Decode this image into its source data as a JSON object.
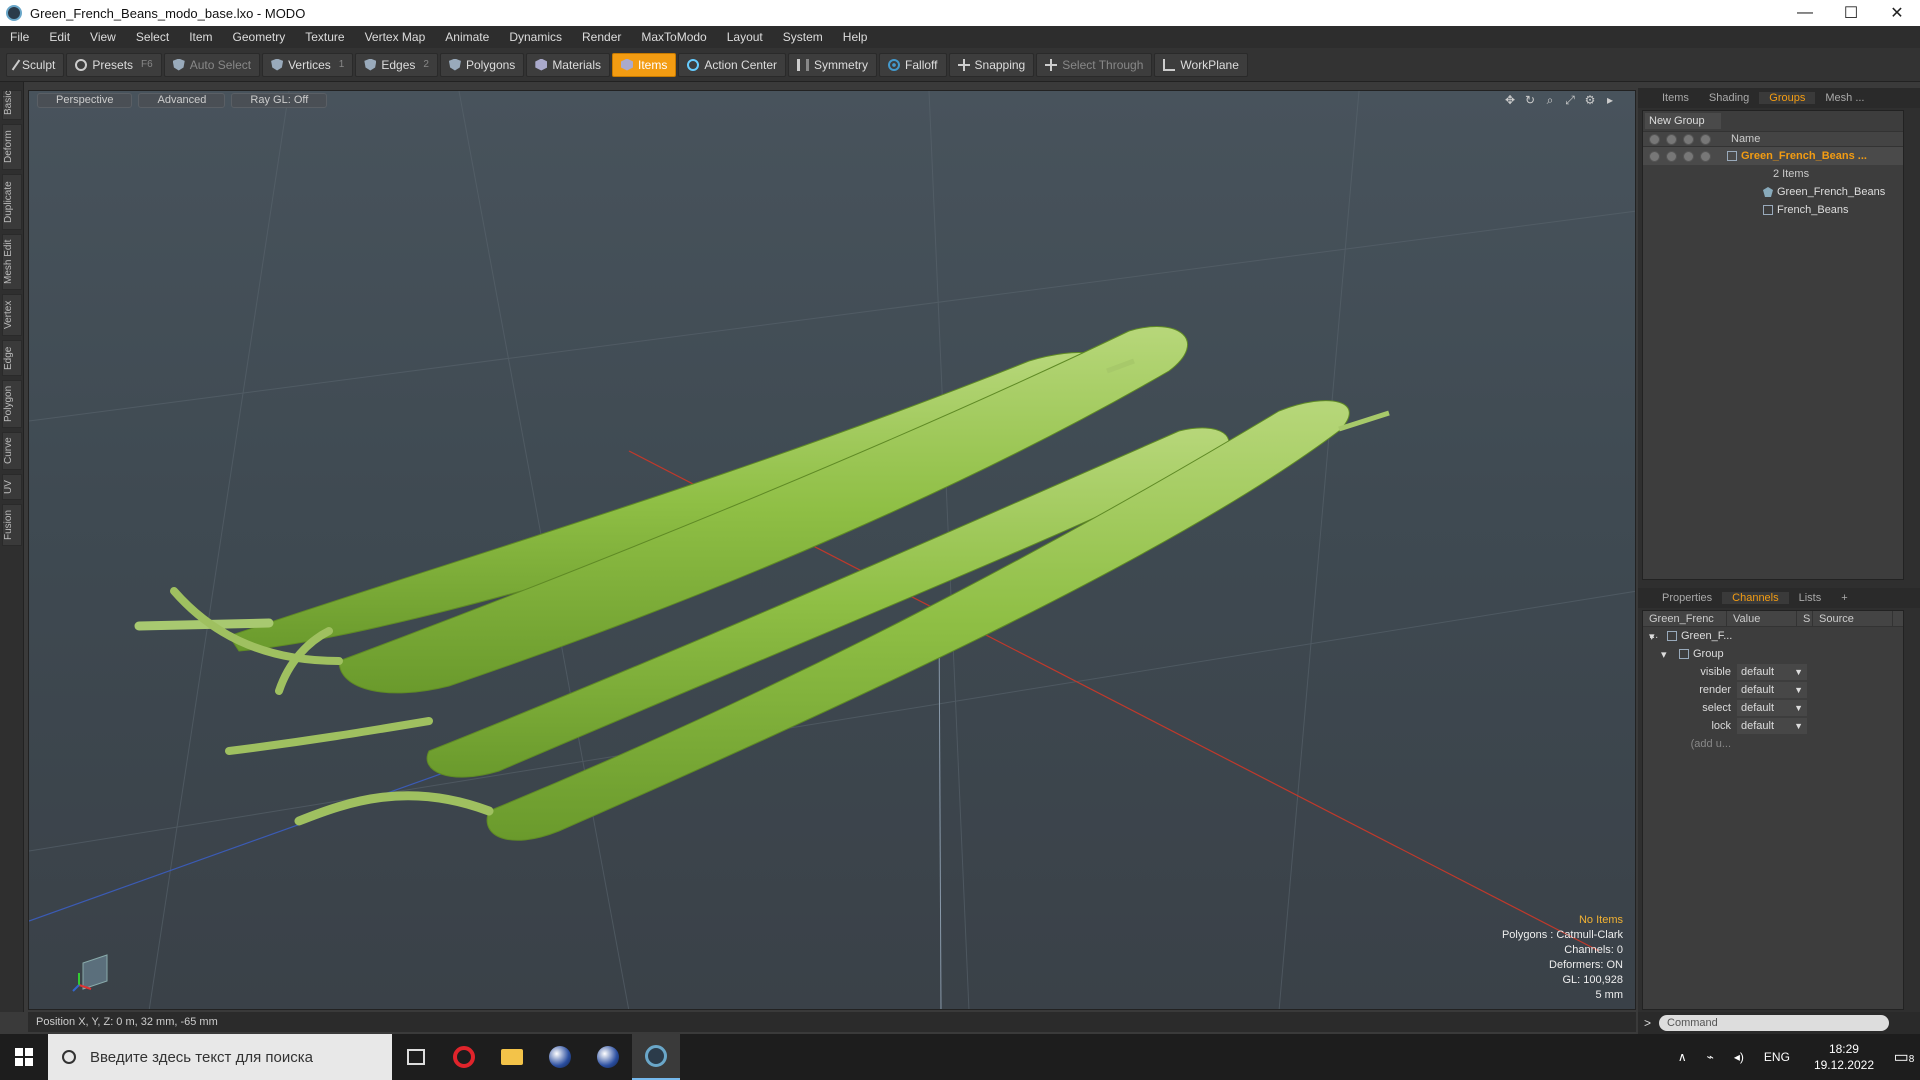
{
  "window": {
    "title": "Green_French_Beans_modo_base.lxo - MODO",
    "minimize": "—",
    "maximize": "☐",
    "close": "✕"
  },
  "menu": [
    "File",
    "Edit",
    "View",
    "Select",
    "Item",
    "Geometry",
    "Texture",
    "Vertex Map",
    "Animate",
    "Dynamics",
    "Render",
    "MaxToModo",
    "Layout",
    "System",
    "Help"
  ],
  "toolbar": {
    "sculpt": "Sculpt",
    "presets": "Presets",
    "presets_key": "F6",
    "auto_select": "Auto Select",
    "vertices": "Vertices",
    "vertices_key": "1",
    "edges": "Edges",
    "edges_key": "2",
    "polygons": "Polygons",
    "materials": "Materials",
    "items": "Items",
    "action_center": "Action Center",
    "symmetry": "Symmetry",
    "falloff": "Falloff",
    "snapping": "Snapping",
    "select_through": "Select Through",
    "workplane": "WorkPlane"
  },
  "left_tabs": [
    "Basic",
    "Deform",
    "Duplicate",
    "Mesh Edit",
    "Vertex",
    "Edge",
    "Polygon",
    "Curve",
    "UV",
    "Fusion"
  ],
  "viewport": {
    "tabs": [
      "Perspective",
      "Advanced",
      "Ray GL: Off"
    ],
    "info": {
      "no_items": "No Items",
      "polygons": "Polygons : Catmull-Clark",
      "channels": "Channels: 0",
      "deformers": "Deformers: ON",
      "gl": "GL: 100,928",
      "scale": "5 mm"
    }
  },
  "status": {
    "position": "Position X, Y, Z:  0 m, 32 mm, -65 mm"
  },
  "groups_panel": {
    "tabs": [
      "Items",
      "Shading",
      "Groups",
      "Mesh ..."
    ],
    "active_tab": "Groups",
    "new_group": "New Group",
    "name_header": "Name",
    "group_name": "Green_French_Beans ...",
    "group_count": "2 Items",
    "children": [
      "Green_French_Beans",
      "French_Beans"
    ]
  },
  "channels_panel": {
    "tabs": [
      "Properties",
      "Channels",
      "Lists",
      "+"
    ],
    "active_tab": "Channels",
    "headers": [
      "Green_Frenc ...",
      "Value",
      "S",
      "Source"
    ],
    "root": "Green_F...",
    "group": "Group",
    "rows": [
      {
        "name": "visible",
        "value": "default"
      },
      {
        "name": "render",
        "value": "default"
      },
      {
        "name": "select",
        "value": "default"
      },
      {
        "name": "lock",
        "value": "default"
      }
    ],
    "add": "(add u..."
  },
  "command": {
    "prompt": ">",
    "placeholder": "Command"
  },
  "taskbar": {
    "search_placeholder": "Введите здесь текст для поиска",
    "lang": "ENG",
    "time": "18:29",
    "date": "19.12.2022",
    "notif_count": "8"
  }
}
